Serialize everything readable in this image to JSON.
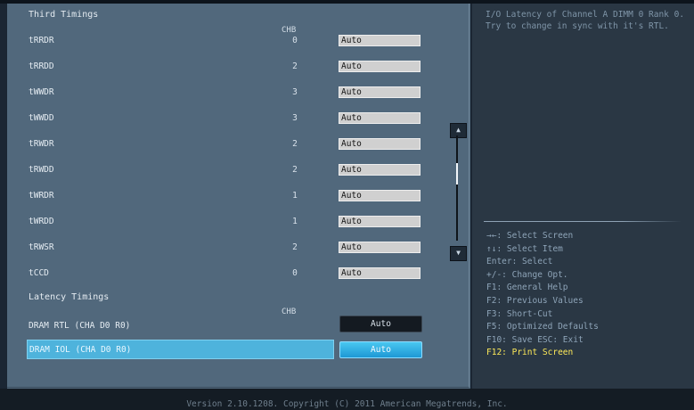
{
  "third_timings": {
    "title": "Third Timings",
    "chb_header": "CHB",
    "rows": [
      {
        "label": "tRRDR",
        "value": "0",
        "setting": "Auto"
      },
      {
        "label": "tRRDD",
        "value": "2",
        "setting": "Auto"
      },
      {
        "label": "tWWDR",
        "value": "3",
        "setting": "Auto"
      },
      {
        "label": "tWWDD",
        "value": "3",
        "setting": "Auto"
      },
      {
        "label": "tRWDR",
        "value": "2",
        "setting": "Auto"
      },
      {
        "label": "tRWDD",
        "value": "2",
        "setting": "Auto"
      },
      {
        "label": "tWRDR",
        "value": "1",
        "setting": "Auto"
      },
      {
        "label": "tWRDD",
        "value": "1",
        "setting": "Auto"
      },
      {
        "label": "tRWSR",
        "value": "2",
        "setting": "Auto"
      },
      {
        "label": "tCCD",
        "value": "0",
        "setting": "Auto"
      }
    ]
  },
  "latency_timings": {
    "title": "Latency Timings",
    "chb_header": "CHB",
    "rows": [
      {
        "label": "DRAM RTL (CHA D0 R0)",
        "setting": "Auto"
      },
      {
        "label": "DRAM IOL (CHA D0 R0)",
        "setting": "Auto",
        "selected": true
      }
    ]
  },
  "help": {
    "description": "I/O Latency of Channel A DIMM 0 Rank 0. Try to change in sync with it's RTL."
  },
  "keys": [
    "→←: Select Screen",
    "↑↓: Select Item",
    "Enter: Select",
    "+/-: Change Opt.",
    "F1: General Help",
    "F2: Previous Values",
    "F3: Short-Cut",
    "F5: Optimized Defaults",
    "F10: Save  ESC: Exit",
    "F12: Print Screen"
  ],
  "footer": "Version 2.10.1208. Copyright (C) 2011 American Megatrends, Inc.",
  "icons": {
    "scroll_up": "triangle-up",
    "scroll_down": "triangle-down"
  },
  "colors": {
    "selected": "#4eb3dc",
    "highlight_key": "#ffeb59"
  }
}
